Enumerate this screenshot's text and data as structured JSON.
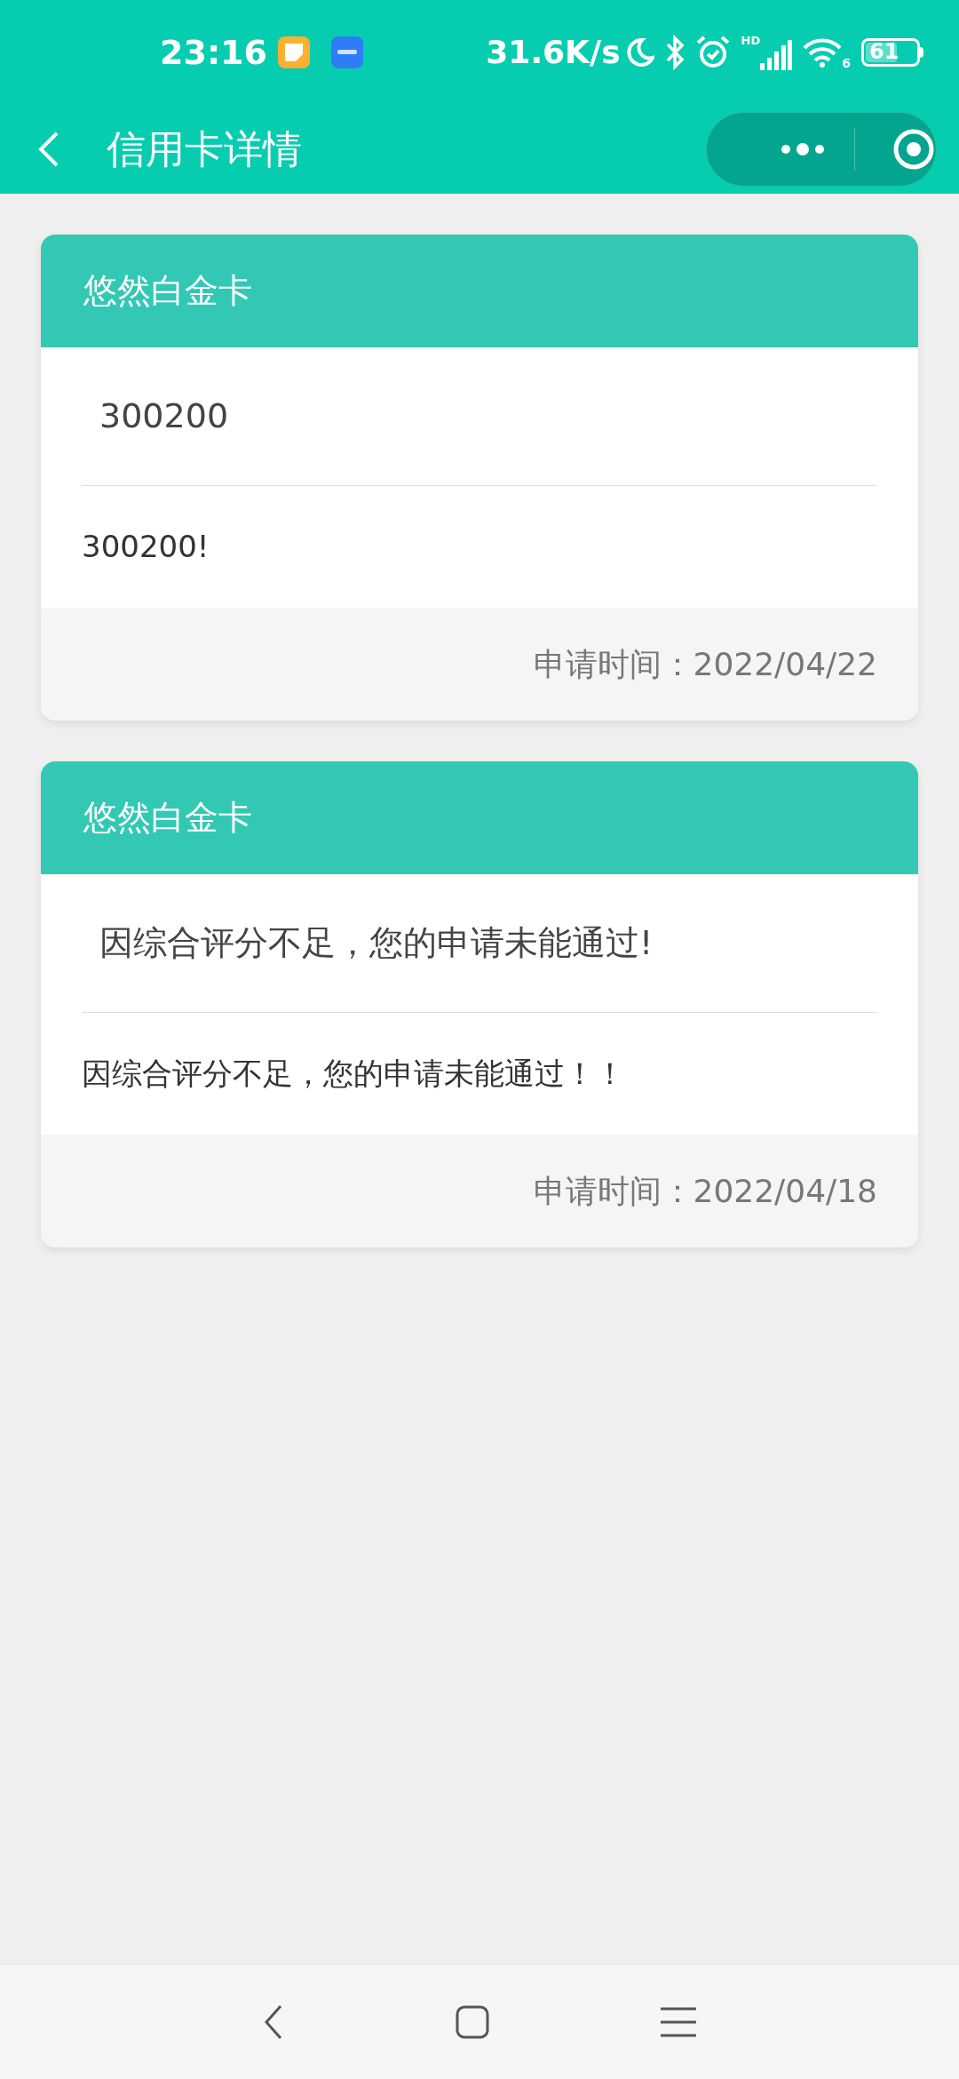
{
  "status_bar": {
    "time": "23:16",
    "net_speed": "31.6K/s",
    "signal_label": "HD",
    "wifi_label": "6",
    "battery": "61"
  },
  "header": {
    "title": "信用卡详情"
  },
  "cards": [
    {
      "title": "悠然白金卡",
      "summary": "300200",
      "detail": "300200!",
      "applied": "申请时间：2022/04/22"
    },
    {
      "title": "悠然白金卡",
      "summary": "因综合评分不足，您的申请未能通过!",
      "detail": "因综合评分不足，您的申请未能通过！！",
      "applied": "申请时间：2022/04/18"
    }
  ]
}
